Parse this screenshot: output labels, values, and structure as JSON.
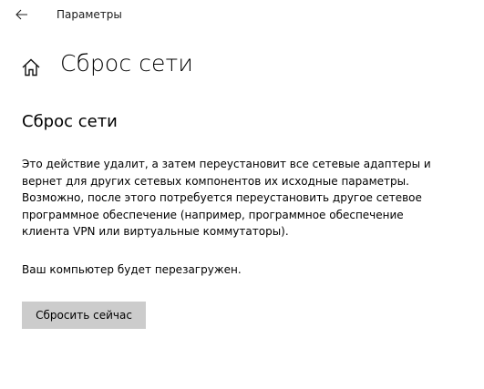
{
  "titlebar": {
    "back_icon": "back-arrow-icon",
    "app_title": "Параметры"
  },
  "header": {
    "home_icon": "home-icon",
    "page_title": "Сброс сети"
  },
  "content": {
    "section_title": "Сброс сети",
    "description_lines": [
      "Это действие удалит, а затем переустановит все сетевые адаптеры и",
      "вернет для других сетевых компонентов их исходные параметры.",
      "Возможно, после этого потребуется переустановить другое сетевое",
      "программное обеспечение (например, программное обеспечение",
      "клиента VPN или виртуальные коммутаторы)."
    ],
    "restart_note": "Ваш компьютер будет перезагружен.",
    "reset_button_label": "Сбросить сейчас"
  }
}
